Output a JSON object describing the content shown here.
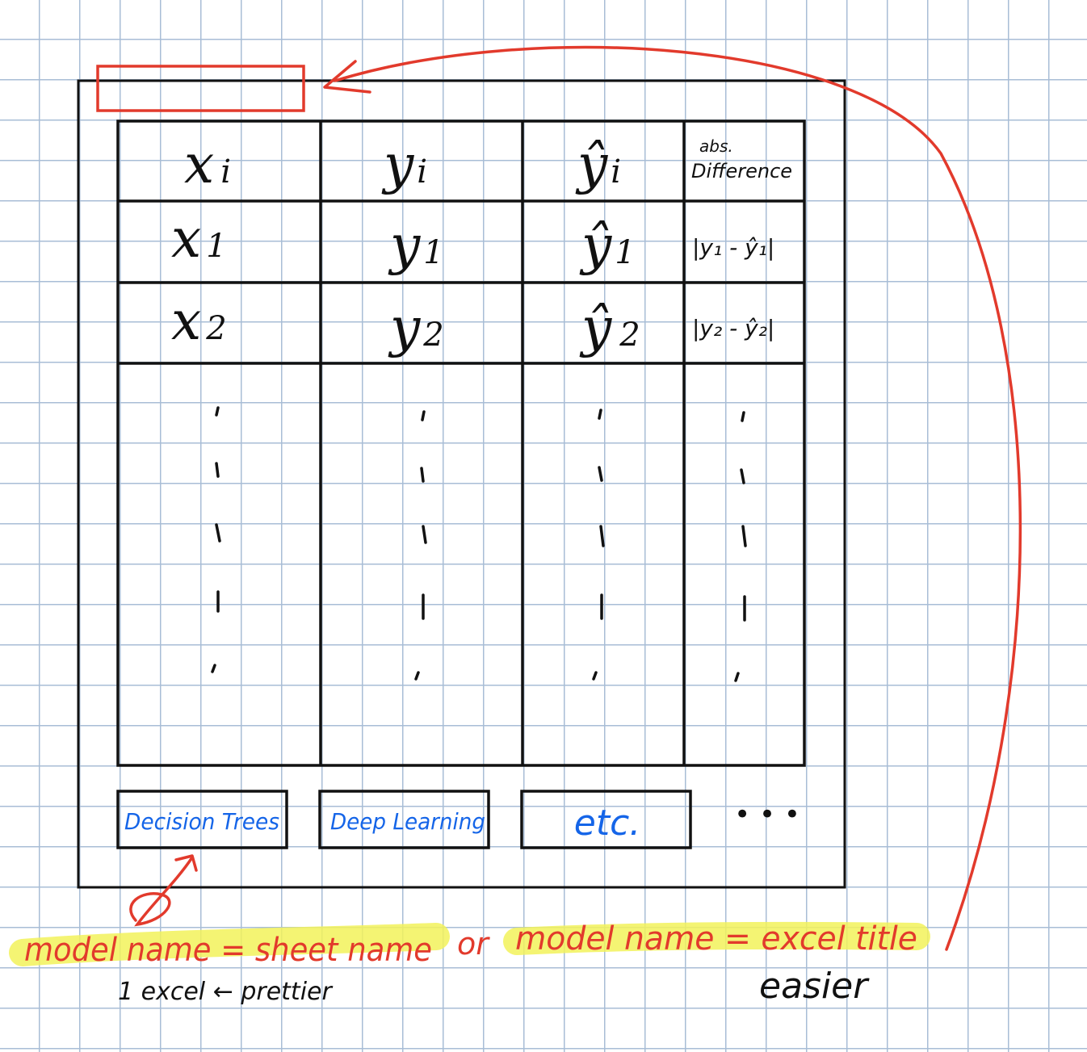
{
  "table": {
    "header": {
      "col1": {
        "base": "x",
        "sub": "i"
      },
      "col2": {
        "base": "y",
        "sub": "i"
      },
      "col3": {
        "base": "ŷ",
        "sub": "i"
      },
      "col4": {
        "line1": "abs.",
        "line2": "Difference"
      }
    },
    "rows": [
      {
        "x": "x",
        "x_sub": "1",
        "y": "y",
        "y_sub": "1",
        "yhat": "ŷ",
        "yhat_sub": "1",
        "diff": "|y₁ - ŷ₁|"
      },
      {
        "x": "x",
        "x_sub": "2",
        "y": "y",
        "y_sub": "2",
        "yhat": "ŷ",
        "yhat_sub": "2",
        "diff": "|y₂ - ŷ₂|"
      }
    ]
  },
  "tabs": [
    {
      "label": "Decision Trees"
    },
    {
      "label": "Deep Learning"
    },
    {
      "label": "etc."
    }
  ],
  "more_tabs": "• • •",
  "notes": {
    "option1": "model name = sheet name",
    "connector": "or",
    "option2": "model name = excel title",
    "option1_comment": "1 excel ← prettier",
    "option2_comment": "easier"
  },
  "colors": {
    "ink": "#111111",
    "tab_text": "#1565e8",
    "annotation": "#e23a2c",
    "highlight": "#f2f25a",
    "grid": "#a8bdd6"
  }
}
